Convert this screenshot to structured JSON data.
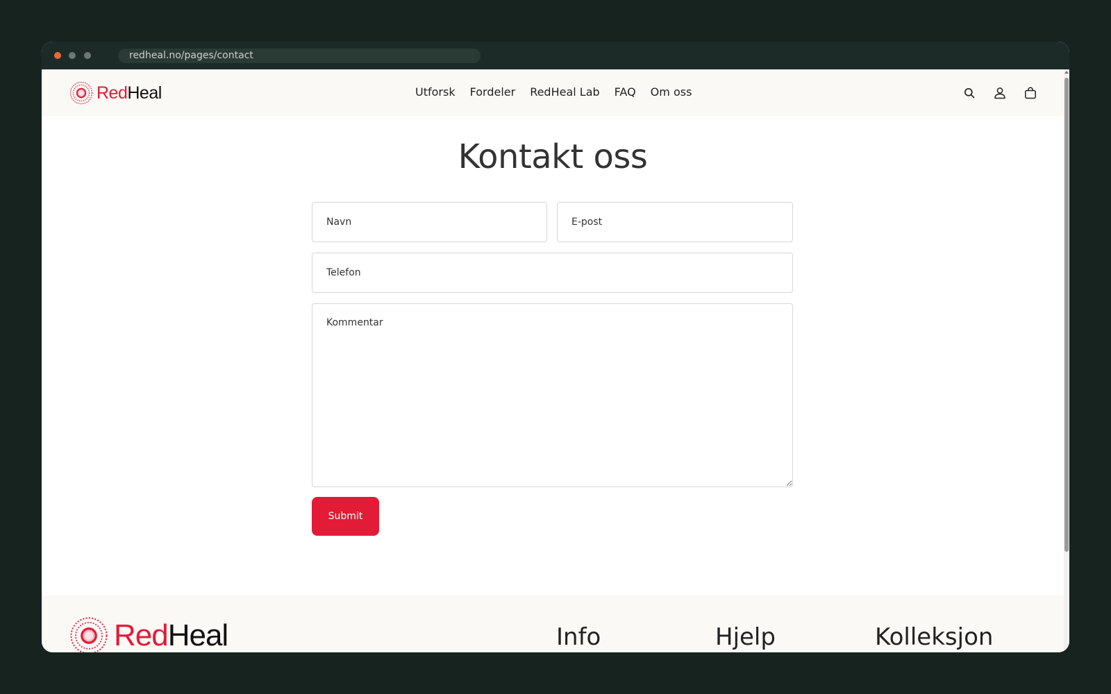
{
  "browser": {
    "url": "redheal.no/pages/contact"
  },
  "header": {
    "logo": {
      "part1": "Red",
      "part2": "Heal"
    },
    "nav": [
      "Utforsk",
      "Fordeler",
      "RedHeal Lab",
      "FAQ",
      "Om oss"
    ],
    "icons": [
      "search-icon",
      "account-icon",
      "cart-icon"
    ]
  },
  "page": {
    "title": "Kontakt oss"
  },
  "form": {
    "name_placeholder": "Navn",
    "email_placeholder": "E-post",
    "phone_placeholder": "Telefon",
    "comment_placeholder": "Kommentar",
    "submit_label": "Submit"
  },
  "footer": {
    "logo": {
      "part1": "Red",
      "part2": "Heal"
    },
    "headings": {
      "info": "Info",
      "help": "Hjelp",
      "collection": "Kolleksjon"
    }
  },
  "colors": {
    "brand_red": "#e31b37",
    "page_bg": "#17231f",
    "header_bg": "#fbf9f6"
  }
}
